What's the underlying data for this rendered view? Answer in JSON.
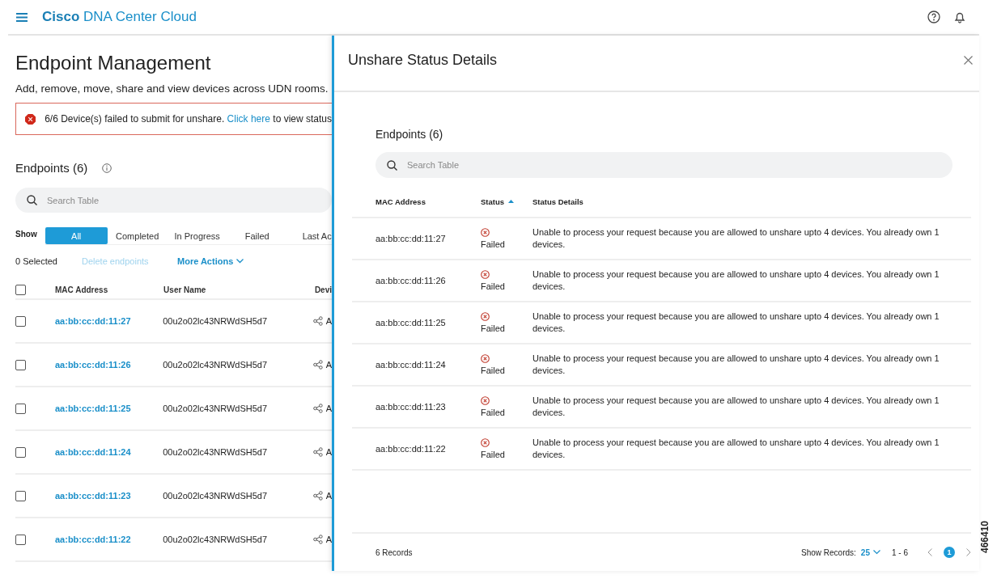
{
  "header": {
    "brand_bold": "Cisco",
    "brand": "DNA Center Cloud"
  },
  "page": {
    "title": "Endpoint Management",
    "subtitle": "Add, remove, move, share and view devices across UDN rooms.",
    "alert": {
      "text": "6/6 Device(s) failed to submit for unshare.",
      "link": "Click here",
      "rest": "to view status"
    },
    "endpoints_title": "Endpoints (6)",
    "search": {
      "placeholder": "Search Table"
    },
    "show_label": "Show",
    "filters": [
      {
        "label": "All",
        "selected": true
      },
      {
        "label": "Completed",
        "selected": false
      },
      {
        "label": "In Progress",
        "selected": false
      },
      {
        "label": "Failed",
        "selected": false
      },
      {
        "label": "Last Ac",
        "selected": false
      }
    ],
    "selected_count": "0 Selected",
    "delete_action": {
      "label": "Delete endpoints",
      "disabled": true
    },
    "more_actions": "More Actions",
    "table": {
      "select_all_checked": false,
      "columns": [
        "MAC Address",
        "User Name",
        "Devi"
      ],
      "rows": [
        {
          "checked": false,
          "mac": "aa:bb:cc:dd:11:27",
          "user": "00u2o02lc43NRWdSH5d7",
          "column_3": "A"
        },
        {
          "checked": false,
          "mac": "aa:bb:cc:dd:11:26",
          "user": "00u2o02lc43NRWdSH5d7",
          "column_3": "A"
        },
        {
          "checked": false,
          "mac": "aa:bb:cc:dd:11:25",
          "user": "00u2o02lc43NRWdSH5d7",
          "column_3": "A"
        },
        {
          "checked": false,
          "mac": "aa:bb:cc:dd:11:24",
          "user": "00u2o02lc43NRWdSH5d7",
          "column_3": "A"
        },
        {
          "checked": false,
          "mac": "aa:bb:cc:dd:11:23",
          "user": "00u2o02lc43NRWdSH5d7",
          "column_3": "A"
        },
        {
          "checked": false,
          "mac": "aa:bb:cc:dd:11:22",
          "user": "00u2o02lc43NRWdSH5d7",
          "column_3": "A"
        }
      ]
    }
  },
  "drawer": {
    "title": "Unshare Status Details",
    "endpoints_title": "Endpoints (6)",
    "search": {
      "placeholder": "Search Table"
    },
    "columns": [
      {
        "label": "MAC Address",
        "sorted": false
      },
      {
        "label": "Status",
        "sorted": true
      },
      {
        "label": "Status Details",
        "sorted": false
      }
    ],
    "rows": [
      {
        "mac": "aa:bb:cc:dd:11:27",
        "status": "Failed",
        "kind": "failed",
        "details": "Unable to process your request because you are allowed to unshare upto 4 devices. You already own 1 devices."
      },
      {
        "mac": "aa:bb:cc:dd:11:26",
        "status": "Failed",
        "kind": "failed",
        "details": "Unable to process your request because you are allowed to unshare upto 4 devices. You already own 1 devices."
      },
      {
        "mac": "aa:bb:cc:dd:11:25",
        "status": "Failed",
        "kind": "failed",
        "details": "Unable to process your request because you are allowed to unshare upto 4 devices. You already own 1 devices."
      },
      {
        "mac": "aa:bb:cc:dd:11:24",
        "status": "Failed",
        "kind": "failed",
        "details": "Unable to process your request because you are allowed to unshare upto 4 devices. You already own 1 devices."
      },
      {
        "mac": "aa:bb:cc:dd:11:23",
        "status": "Failed",
        "kind": "failed",
        "details": "Unable to process your request because you are allowed to unshare upto 4 devices. You already own 1 devices."
      },
      {
        "mac": "aa:bb:cc:dd:11:22",
        "status": "Failed",
        "kind": "failed",
        "details": "Unable to process your request because you are allowed to unshare upto 4 devices. You already own 1 devices."
      }
    ],
    "footer": {
      "records": "6 Records",
      "show_records_label": "Show Records:",
      "page_size": "25",
      "range": "1 - 6",
      "pages": [
        {
          "label": "1",
          "selected": true
        }
      ]
    }
  },
  "figure_id": "466410"
}
